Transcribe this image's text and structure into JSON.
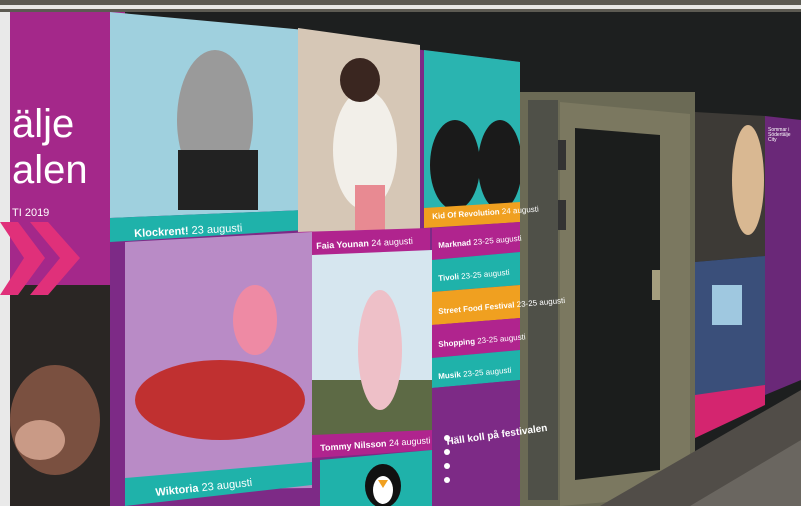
{
  "poster": {
    "brand_line1": "älje",
    "brand_line2": "alen",
    "brand_year": "TI 2019",
    "panels": [
      {
        "name": "Klockrent!",
        "date": "23 augusti"
      },
      {
        "name": "Faia Younan",
        "date": "24 augusti"
      },
      {
        "name": "Kid Of Revolution",
        "date": "24 augusti"
      },
      {
        "name": "Wiktoria",
        "date": "23 augusti"
      },
      {
        "name": "Tommy Nilsson",
        "date": "24 augusti"
      }
    ],
    "schedule": [
      {
        "label": "Marknad",
        "dates": "23-25 augusti"
      },
      {
        "label": "Tivoli",
        "dates": "23-25 augusti"
      },
      {
        "label": "Street Food Festival",
        "dates": "23-25 augusti"
      },
      {
        "label": "Shopping",
        "dates": "23-25 augusti"
      },
      {
        "label": "Musik",
        "dates": "23-25 augusti"
      }
    ],
    "contact_title": "Häll koll på festivalen"
  },
  "right_poster": {
    "title": "Sommar i Södertälje City"
  },
  "colors": {
    "magenta": "#b0248e",
    "teal": "#1fb2aa",
    "orange": "#f0a020",
    "purple": "#7d2a86",
    "pink_chevron": "#e0307a"
  }
}
